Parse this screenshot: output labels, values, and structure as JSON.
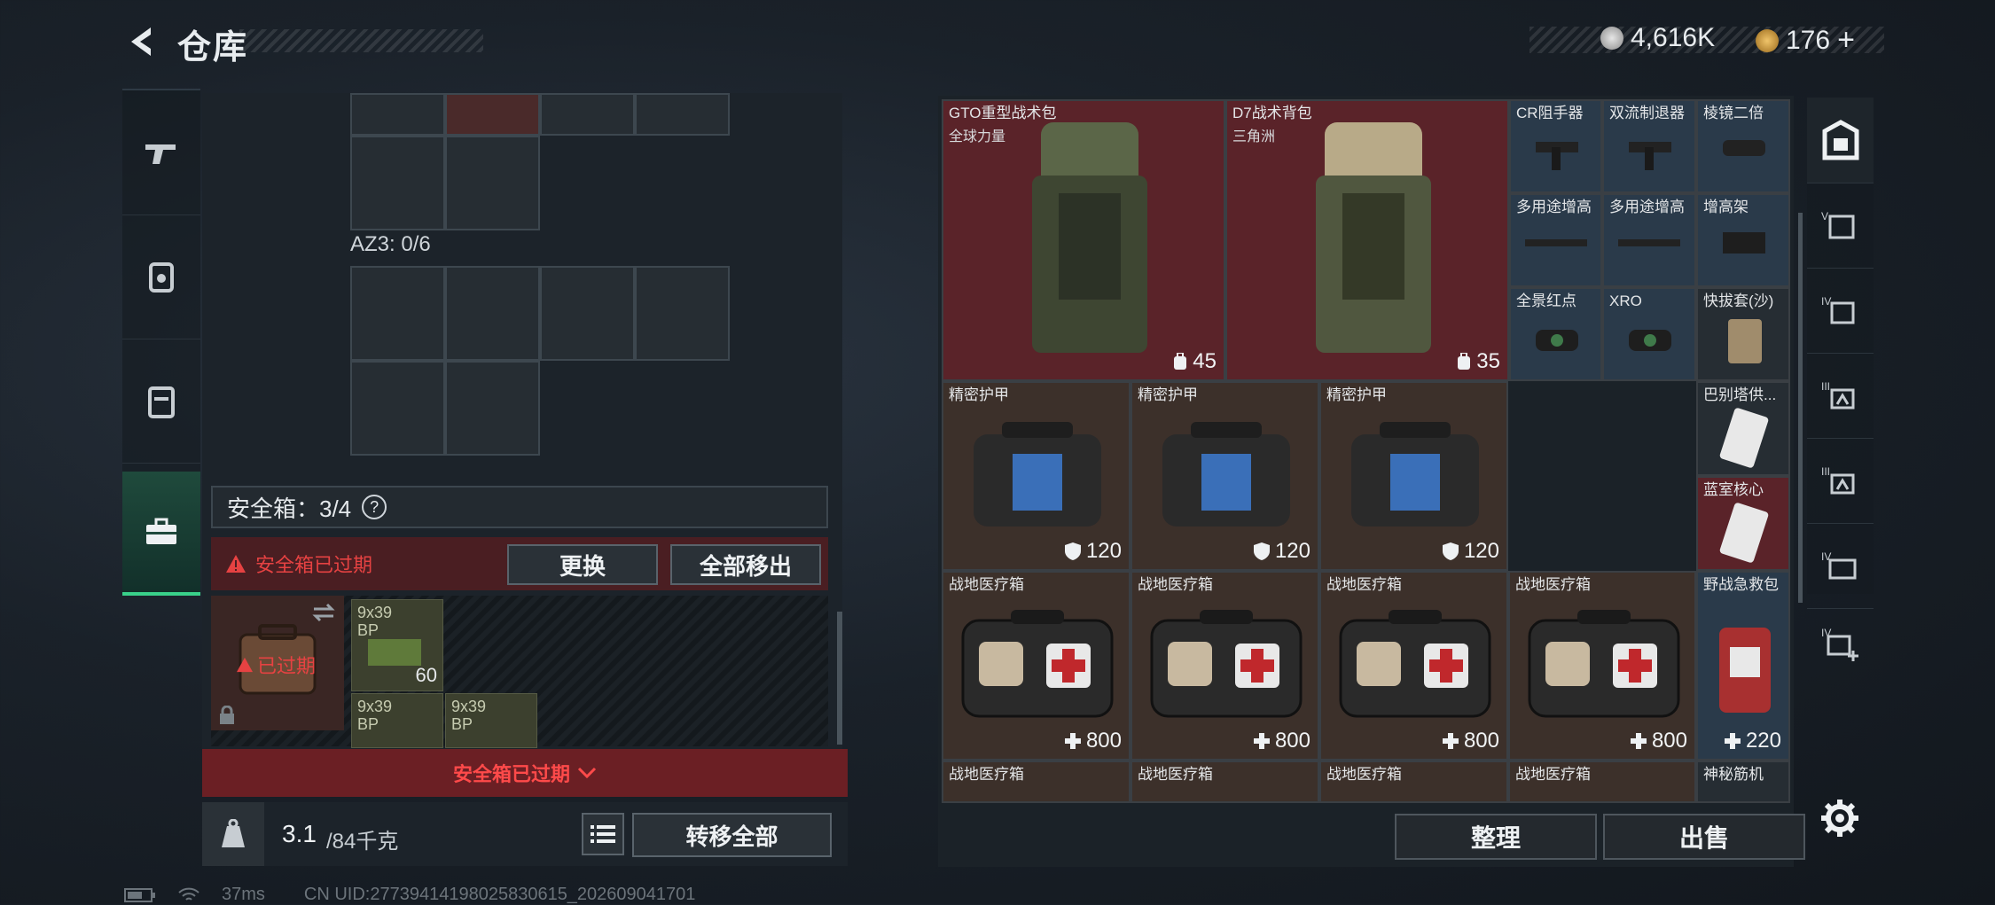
{
  "header": {
    "title": "仓库",
    "currency": [
      {
        "icon": "silver-coin-icon",
        "value": "4,616K"
      },
      {
        "icon": "gold-coin-icon",
        "value": "176"
      }
    ],
    "add_label": "+"
  },
  "left_sidebar": {
    "tabs": [
      {
        "icon": "gun-icon",
        "active": false
      },
      {
        "icon": "helmet-icon",
        "active": false
      },
      {
        "icon": "backpack-icon",
        "active": false
      },
      {
        "icon": "briefcase-icon",
        "active": true
      }
    ]
  },
  "left_panel": {
    "az3_label": "AZ3: 0/6",
    "safe_box_label": "安全箱：3/4",
    "help_label": "?",
    "expired_warning": "安全箱已过期",
    "replace_button": "更换",
    "remove_all_button": "全部移出",
    "case_expired_label": "已过期",
    "ammo": [
      {
        "name_line1": "9x39",
        "name_line2": "BP",
        "count": "60"
      },
      {
        "name_line1": "9x39",
        "name_line2": "BP",
        "count": ""
      },
      {
        "name_line1": "9x39",
        "name_line2": "BP",
        "count": ""
      }
    ],
    "bottom_expired": "安全箱已过期",
    "weight_value": "3.1",
    "weight_max": "/84千克",
    "transfer_all_button": "转移全部"
  },
  "items": [
    {
      "name": "GTO重型战术包",
      "sub": "全球力量",
      "value": "45",
      "icon": "backpack-icon"
    },
    {
      "name": "D7战术背包",
      "sub": "三角洲",
      "value": "35",
      "icon": "backpack-icon"
    },
    {
      "name": "CR阻手器",
      "value": ""
    },
    {
      "name": "双流制退器",
      "value": ""
    },
    {
      "name": "棱镜二倍",
      "value": ""
    },
    {
      "name": "多用途增高",
      "value": ""
    },
    {
      "name": "多用途增高",
      "value": ""
    },
    {
      "name": "增高架",
      "value": ""
    },
    {
      "name": "全景红点",
      "value": ""
    },
    {
      "name": "XRO",
      "value": ""
    },
    {
      "name": "快拔套(沙)",
      "value": ""
    },
    {
      "name": "精密护甲",
      "value": "120",
      "icon": "shield-icon"
    },
    {
      "name": "精密护甲",
      "value": "120",
      "icon": "shield-icon"
    },
    {
      "name": "精密护甲",
      "value": "120",
      "icon": "shield-icon"
    },
    {
      "name": "巴别塔供...",
      "value": ""
    },
    {
      "name": "蓝室核心",
      "value": ""
    },
    {
      "name": "战地医疗箱",
      "value": "800",
      "icon": "heal-icon"
    },
    {
      "name": "战地医疗箱",
      "value": "800",
      "icon": "heal-icon"
    },
    {
      "name": "战地医疗箱",
      "value": "800",
      "icon": "heal-icon"
    },
    {
      "name": "战地医疗箱",
      "value": "800",
      "icon": "heal-icon"
    },
    {
      "name": "野战急救包",
      "value": "220",
      "icon": "heal-icon"
    },
    {
      "name": "战地医疗箱",
      "value": ""
    },
    {
      "name": "战地医疗箱",
      "value": ""
    },
    {
      "name": "战地医疗箱",
      "value": ""
    },
    {
      "name": "战地医疗箱",
      "value": ""
    },
    {
      "name": "神秘筋机",
      "value": ""
    }
  ],
  "right_buttons": {
    "sort": "整理",
    "sell": "出售"
  },
  "right_sidebar": {
    "tabs": [
      "safe-icon",
      "vest-icon",
      "iv-vest-icon",
      "iii-armor-icon",
      "iii-armor-icon",
      "iv-folder-icon",
      "iv-add-icon"
    ],
    "settings": "gear-icon"
  },
  "status": {
    "ping": "37ms",
    "uid": "CN UID:27739414198025830615_202609041701"
  }
}
